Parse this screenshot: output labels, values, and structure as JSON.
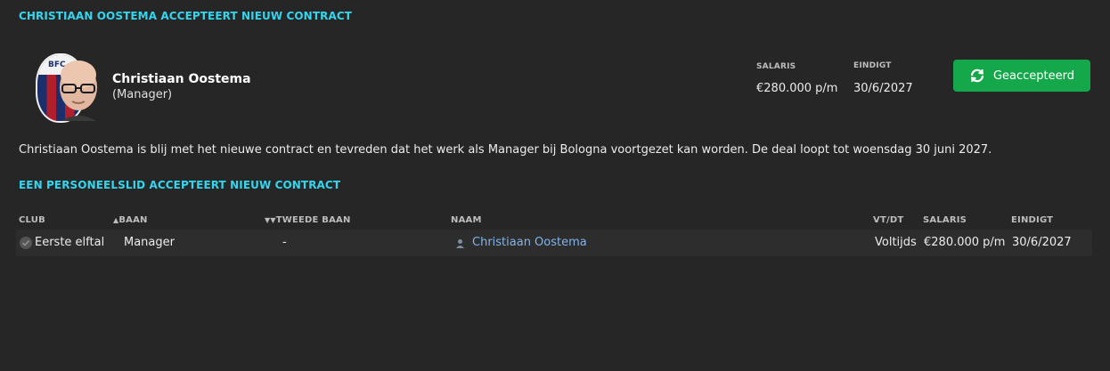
{
  "section1": {
    "title": "CHRISTIAAN OOSTEMA ACCEPTEERT NIEUW CONTRACT"
  },
  "player": {
    "name": "Christiaan Oostema",
    "role": "(Manager)",
    "crest_text": "BFC"
  },
  "contract": {
    "salary_label": "SALARIS",
    "salary_value": "€280.000 p/m",
    "end_label": "EINDIGT",
    "end_value": "30/6/2027"
  },
  "status_button": {
    "label": "Geaccepteerd",
    "icon": "refresh-icon",
    "color": "#14a84a"
  },
  "description": "Christiaan Oostema is blij met het nieuwe contract en tevreden dat het werk als Manager bij Bologna voortgezet kan worden. De deal loopt tot woensdag 30 juni 2027.",
  "section2": {
    "title": "EEN PERSONEELSLID ACCEPTEERT NIEUW CONTRACT"
  },
  "table": {
    "headers": {
      "club": "CLUB",
      "baan": "BAAN",
      "tweede_baan": "TWEEDE BAAN",
      "naam": "NAAM",
      "vtdt": "VT/DT",
      "salaris": "SALARIS",
      "eindigt": "EINDIGT"
    },
    "rows": [
      {
        "club": "Eerste elftal",
        "baan": "Manager",
        "tweede_baan": "-",
        "naam": "Christiaan Oostema",
        "vtdt": "Voltijds",
        "salaris": "€280.000 p/m",
        "eindigt": "30/6/2027"
      }
    ]
  },
  "colors": {
    "accent": "#33d6ee",
    "background": "#262626",
    "link": "#7fb4ec"
  }
}
